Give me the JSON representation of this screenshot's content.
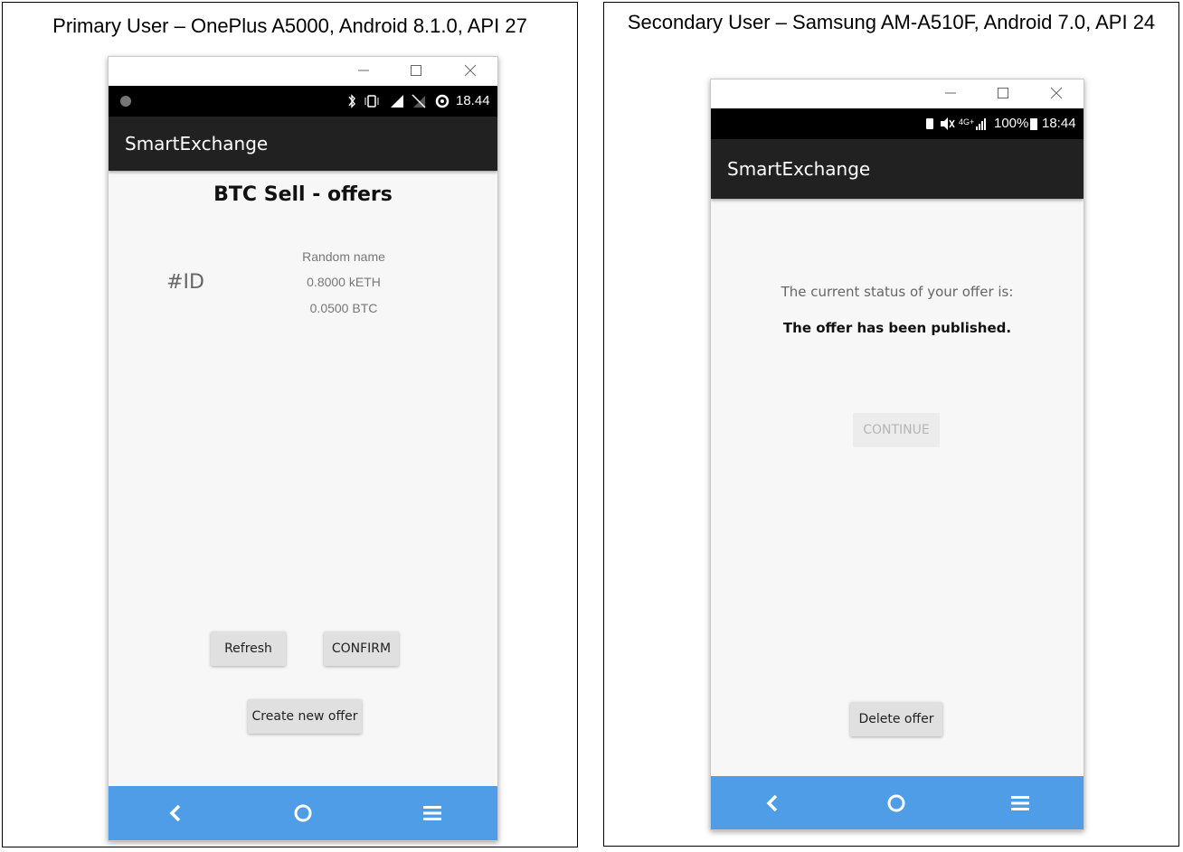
{
  "left_panel": {
    "heading": "Primary User – OnePlus A5000, Android 8.1.0, API 27",
    "status_bar": {
      "time": "18.44"
    },
    "app_title": "SmartExchange",
    "screen_title": "BTC Sell - offers",
    "offer": {
      "id_label": "#ID",
      "name": "Random name",
      "amount_eth": "0.8000 kETH",
      "amount_btc": "0.0500 BTC"
    },
    "buttons": {
      "refresh": "Refresh",
      "confirm": "CONFIRM",
      "create_offer": "Create new offer"
    }
  },
  "right_panel": {
    "heading": "Secondary User – Samsung AM-A510F, Android 7.0, API 24",
    "status_bar": {
      "battery": "100%",
      "time": "18:44",
      "network": "4G+"
    },
    "app_title": "SmartExchange",
    "status_prompt": "The current status of your offer is:",
    "status_value": "The offer has been published.",
    "buttons": {
      "continue": "CONTINUE",
      "delete_offer": "Delete offer"
    }
  },
  "icons": {
    "window": [
      "minimize-icon",
      "maximize-icon",
      "close-icon"
    ],
    "nav": [
      "back-icon",
      "home-icon",
      "menu-icon"
    ],
    "status_left": [
      "notification-dot-icon",
      "bluetooth-icon",
      "vibrate-icon",
      "signal-icon",
      "wifi-off-icon",
      "location-icon"
    ],
    "status_right": [
      "sim-icon",
      "mute-icon",
      "signal-icon",
      "battery-icon"
    ]
  },
  "colors": {
    "app_bar": "#212121",
    "nav_bar": "#4e9de6",
    "status_bar": "#000000",
    "button": "#e0e0e0",
    "screen_bg": "#f7f7f7"
  }
}
